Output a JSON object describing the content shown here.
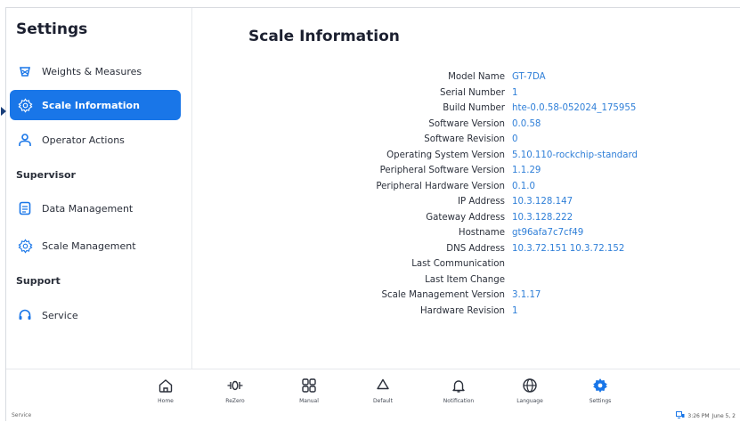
{
  "sidebar": {
    "title": "Settings",
    "items": [
      {
        "label": "Weights & Measures",
        "icon": "scale-icon"
      },
      {
        "label": "Scale Information",
        "icon": "gear-icon",
        "active": true
      },
      {
        "label": "Operator Actions",
        "icon": "person-icon"
      },
      {
        "label": "Data Management",
        "icon": "document-icon"
      },
      {
        "label": "Scale Management",
        "icon": "gear-icon"
      },
      {
        "label": "Service",
        "icon": "headset-icon"
      }
    ],
    "sections": [
      "Supervisor",
      "Support"
    ]
  },
  "main": {
    "title": "Scale Information",
    "rows": [
      {
        "label": "Model Name",
        "value": "GT-7DA"
      },
      {
        "label": "Serial Number",
        "value": "1"
      },
      {
        "label": "Build Number",
        "value": "hte-0.0.58-052024_175955"
      },
      {
        "label": "Software Version",
        "value": "0.0.58"
      },
      {
        "label": "Software Revision",
        "value": "0"
      },
      {
        "label": "Operating System Version",
        "value": "5.10.110-rockchip-standard"
      },
      {
        "label": "Peripheral Software Version",
        "value": "1.1.29"
      },
      {
        "label": "Peripheral Hardware Version",
        "value": "0.1.0"
      },
      {
        "label": "IP Address",
        "value": "10.3.128.147"
      },
      {
        "label": "Gateway Address",
        "value": "10.3.128.222"
      },
      {
        "label": "Hostname",
        "value": "gt96afa7c7cf49"
      },
      {
        "label": "DNS Address",
        "value": "10.3.72.151 10.3.72.152"
      },
      {
        "label": "Last Communication",
        "value": ""
      },
      {
        "label": "Last Item Change",
        "value": ""
      },
      {
        "label": "Scale Management Version",
        "value": "3.1.17"
      },
      {
        "label": "Hardware Revision",
        "value": "1"
      }
    ]
  },
  "bottom": {
    "left_tag": "Service",
    "nav": [
      {
        "label": "Home",
        "icon": "home-icon"
      },
      {
        "label": "ReZero",
        "icon": "rezero-icon"
      },
      {
        "label": "Manual",
        "icon": "grid-icon"
      },
      {
        "label": "Default",
        "icon": "recycle-icon"
      },
      {
        "label": "Notification",
        "icon": "bell-icon"
      },
      {
        "label": "Language",
        "icon": "globe-icon"
      },
      {
        "label": "Settings",
        "icon": "gear-icon",
        "active": true
      }
    ],
    "status_time": "3:26 PM",
    "status_date": "June 5, 2"
  },
  "colors": {
    "accent": "#1976e8",
    "value_text": "#2f7fd8"
  }
}
